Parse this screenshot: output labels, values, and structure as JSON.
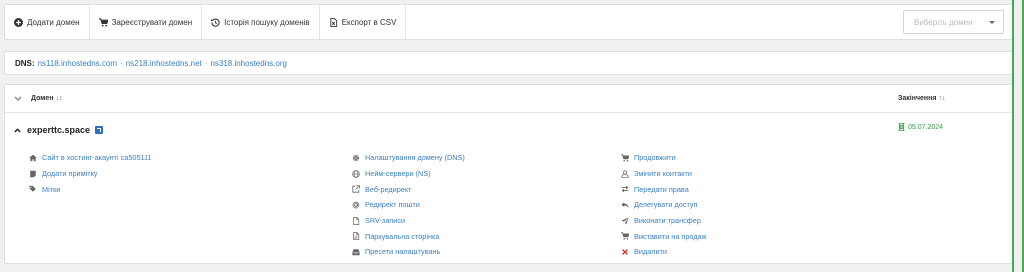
{
  "toolbar": {
    "add_domain": "Додати домен",
    "register_domain": "Зареєструвати домен",
    "search_history": "Історія пошуку доменів",
    "export_csv": "Експорт в CSV",
    "select_placeholder": "Виберіть домен"
  },
  "dns": {
    "label": "DNS:",
    "servers": [
      "ns118.inhostedns.com",
      "ns218.inhostedns.net",
      "ns318.inhostedns.org"
    ],
    "separator": "·"
  },
  "table": {
    "col_domain": "Домен",
    "col_expiry": "Закінчення",
    "sort_domain_icon": "↓↕",
    "sort_expiry_icon": "↑↓"
  },
  "domain": {
    "name": "experttc.space",
    "expiry": "05.07.2024",
    "col1": [
      {
        "label": "Сайт в хостинг-акаунті ca505111",
        "icon": "home-icon"
      },
      {
        "label": "Додати примітку",
        "icon": "note-icon"
      },
      {
        "label": "Мітки",
        "icon": "tags-icon"
      }
    ],
    "col2": [
      {
        "label": "Налаштування домену (DNS)",
        "icon": "cog-icon"
      },
      {
        "label": "Нейм-сервери (NS)",
        "icon": "globe-icon"
      },
      {
        "label": "Веб-редирект",
        "icon": "external-link-icon"
      },
      {
        "label": "Редирект пошти",
        "icon": "at-icon"
      },
      {
        "label": "SRV-записи",
        "icon": "file-icon"
      },
      {
        "label": "Паркувальна сторінка",
        "icon": "file-text-icon"
      },
      {
        "label": "Пресети налаштувань",
        "icon": "inbox-icon"
      }
    ],
    "col3": [
      {
        "label": "Продовжити",
        "icon": "cart-icon"
      },
      {
        "label": "Змінити контакти",
        "icon": "user-icon"
      },
      {
        "label": "Передати права",
        "icon": "exchange-icon"
      },
      {
        "label": "Делегувати доступ",
        "icon": "reply-icon"
      },
      {
        "label": "Виконати трансфер",
        "icon": "send-icon"
      },
      {
        "label": "Виставити на продаж",
        "icon": "cart-plus-icon"
      },
      {
        "label": "Видалити",
        "icon": "delete-icon"
      }
    ]
  },
  "colors": {
    "link": "#3a7fc4",
    "expiry_green": "#3aa04a",
    "delete_red": "#d9342b",
    "icon_gray": "#666666"
  }
}
